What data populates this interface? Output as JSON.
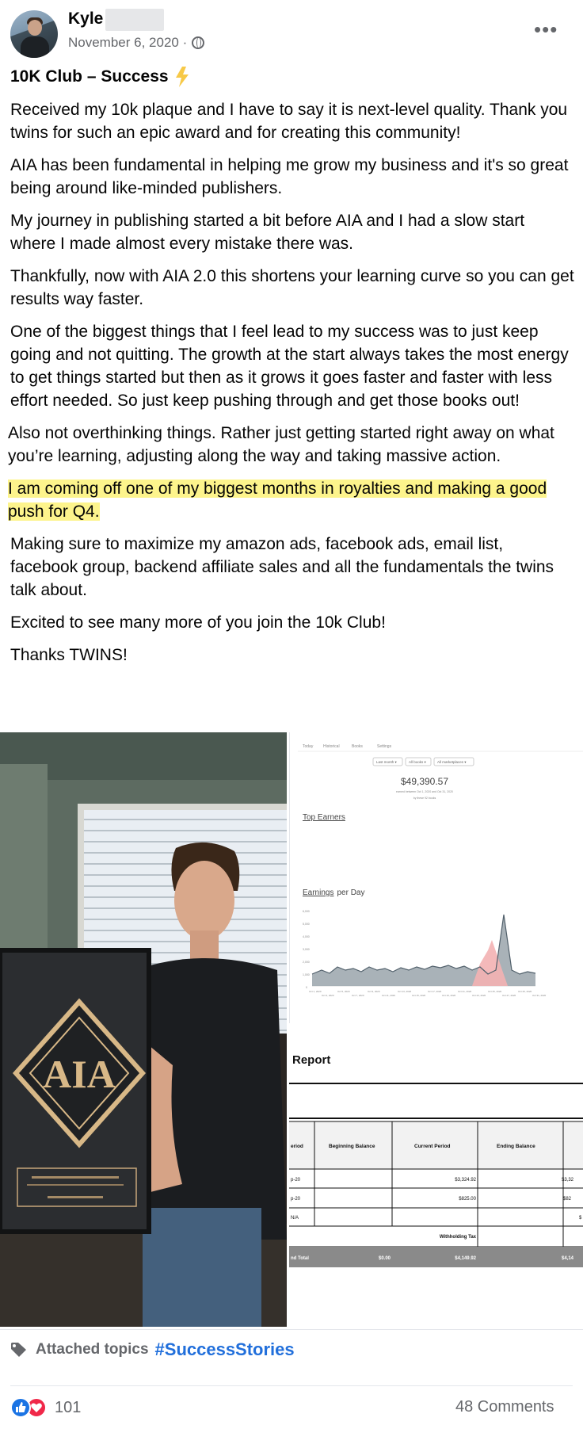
{
  "post": {
    "author": "Kyle",
    "date": "November 6, 2020 ·",
    "title": "10K Club – Success",
    "paragraphs": [
      "Received my 10k plaque and I have to say it is next-level quality. Thank you twins for such an epic award and for creating this community!",
      "AIA has been fundamental in helping me grow my business and it's so great being around like-minded publishers.",
      "My journey in publishing started a bit before AIA and I had a slow start where I made almost every mistake there was.",
      "Thankfully, now with AIA 2.0 this shortens your learning curve so you can get results way faster.",
      "One of the biggest things that I feel lead to my success was to just keep going and not quitting. The growth at the start always takes the most energy to get things started but then as it grows it goes faster and faster with less effort needed. So just keep pushing through and get those books out!",
      "Also not overthinking things. Rather just getting started right away on what you’re learning, adjusting along the way and taking massive action.",
      "I am coming off one of my biggest months in royalties and making a good push for Q4.",
      "Making sure to maximize my amazon ads, facebook ads, email list, facebook group, backend affiliate sales and all the fundamentals the twins talk about.",
      "Excited to see many more of you join the 10k Club!",
      "Thanks TWINS!"
    ]
  },
  "photo": {
    "plaque_letters": "AIA"
  },
  "dashboard": {
    "tabs": [
      "Today",
      "Historical",
      "Books",
      "Settings"
    ],
    "filters": [
      "Last month ▾",
      "All books ▾",
      "All marketplaces ▾"
    ],
    "total": "$49,390.57",
    "total_sub1": "earned between Oct 1, 2020 and Oct 31, 2020",
    "total_sub2": "by these 92 books",
    "top_earners": "Top Earners",
    "earnings_label": "Earnings",
    "per_day": "per Day",
    "y_ticks": [
      "6,000",
      "5,000",
      "4,000",
      "3,000",
      "2,000",
      "1,000",
      "0"
    ],
    "x_ticks_top": [
      "Oct 1, 2020",
      "Oct 5, 2020",
      "Oct 9, 2020",
      "Oct 13, 2020",
      "Oct 17, 2020",
      "Oct 21, 2020",
      "Oct 25, 2020",
      "Oct 29, 2020"
    ],
    "x_ticks_bottom": [
      "Oct 3, 2020",
      "Oct 7, 2020",
      "Oct 11, 2020",
      "Oct 15, 2020",
      "Oct 19, 2020",
      "Oct 23, 2020",
      "Oct 27, 2020",
      "Oct 31, 2020"
    ]
  },
  "report": {
    "title": "Report",
    "columns": [
      "eriod",
      "Beginning Balance",
      "Current Period",
      "Ending Balance"
    ],
    "rows": [
      [
        "p-20",
        "",
        "$3,324.92",
        "$3,32"
      ],
      [
        "p-20",
        "",
        "$825.00",
        "$82"
      ],
      [
        "N/A",
        "",
        "",
        "$"
      ]
    ],
    "withholding": "Withholding Tax",
    "total_row": [
      "nd Total",
      "$0.00",
      "$4,149.92",
      "$4,14"
    ]
  },
  "footer": {
    "attached_topics": "Attached topics",
    "topic": "#SuccessStories",
    "reaction_count": "101",
    "comments": "48 Comments"
  }
}
